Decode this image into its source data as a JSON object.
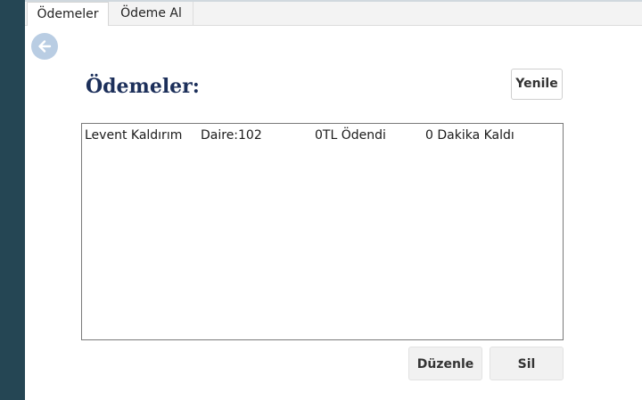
{
  "tabs": [
    {
      "label": "Ödemeler",
      "active": true
    },
    {
      "label": "Ödeme Al",
      "active": false
    }
  ],
  "page": {
    "title": "Ödemeler:",
    "refresh_label": "Yenile",
    "edit_label": "Düzenle",
    "delete_label": "Sil",
    "back_icon": "arrow-left-icon"
  },
  "payments": [
    {
      "name": "Levent Kaldırım",
      "unit": "Daire:102",
      "amount": "0TL Ödendi",
      "remaining": "0 Dakika Kaldı"
    }
  ],
  "colors": {
    "sidebar": "#254654",
    "title": "#1c2f5a",
    "back_button": "#b9cde3"
  }
}
